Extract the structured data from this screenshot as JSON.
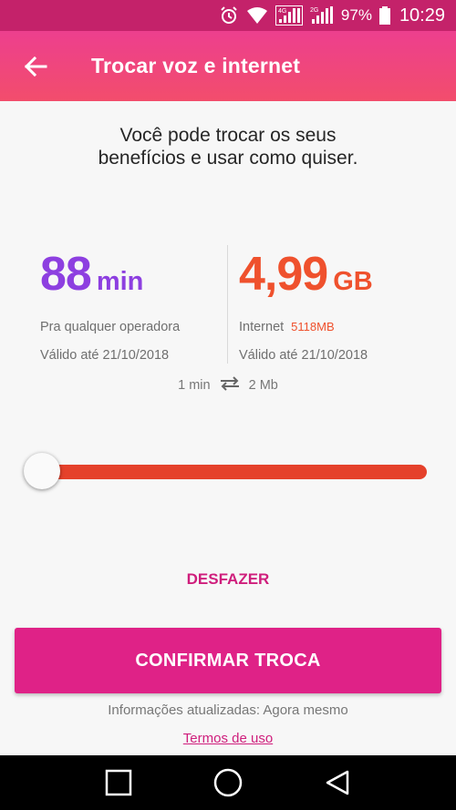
{
  "status_bar": {
    "icons": [
      "alarm-icon",
      "wifi-icon",
      "signal-4g-icon",
      "signal-2g-icon",
      "battery-icon"
    ],
    "network_4g": "4G",
    "network_2g": "2G",
    "battery": "97%",
    "time": "10:29"
  },
  "header": {
    "title": "Trocar voz e internet",
    "back_icon": "arrow-left-icon",
    "background_color": "#ec3e88"
  },
  "intro_text": "Você pode trocar os seus benefícios e usar como quiser.",
  "voice": {
    "amount": "88",
    "unit": "min",
    "description": "Pra qualquer operadora",
    "validity": "Válido até 21/10/2018",
    "color": "#8d3fe0"
  },
  "data": {
    "amount": "4,99",
    "unit": "GB",
    "description": "Internet",
    "description_highlight": "5118MB",
    "validity": "Válido até 21/10/2018",
    "color": "#ef512d"
  },
  "exchange_rate": {
    "left": "1 min",
    "right": "2 Mb",
    "icon": "swap-arrows-icon"
  },
  "slider": {
    "value_fraction": 0.0,
    "track_color": "#e5412b"
  },
  "undo_label": "DESFAZER",
  "confirm_label": "CONFIRMAR TROCA",
  "updated_text": "Informações atualizadas: Agora mesmo",
  "terms_label": "Termos de uso",
  "accent_color": "#df2287",
  "navigation": {
    "icons": [
      "recents-square-icon",
      "home-circle-icon",
      "back-triangle-icon"
    ]
  }
}
